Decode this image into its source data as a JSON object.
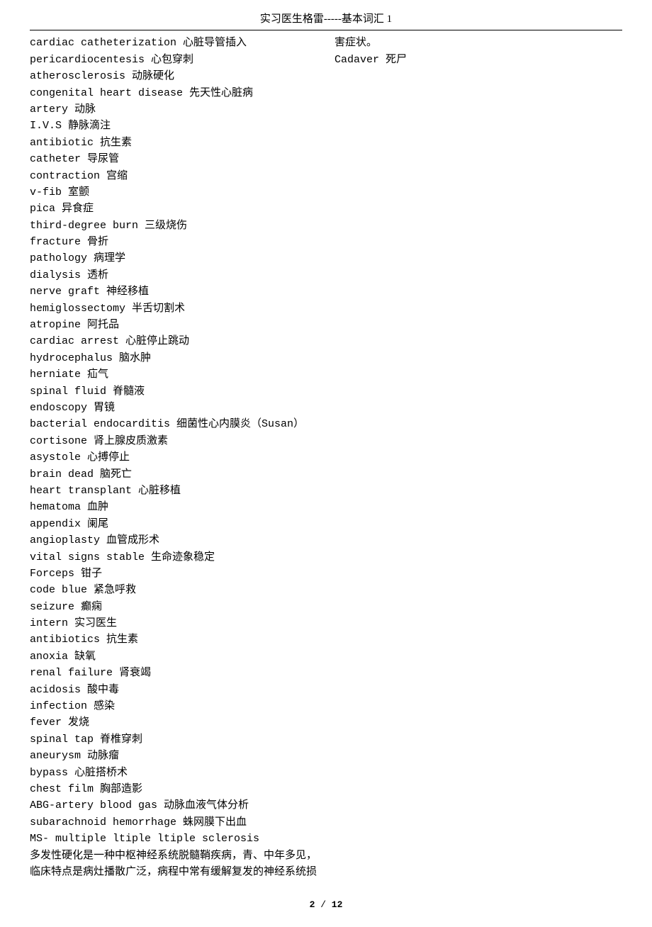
{
  "header": "实习医生格雷-----基本词汇 1",
  "terms": [
    {
      "text": "cardiac catheterization 心脏导管插入",
      "type": "term"
    },
    {
      "text": "pericardiocentesis 心包穿刺",
      "type": "term"
    },
    {
      "text": "atherosclerosis 动脉硬化",
      "type": "term"
    },
    {
      "text": "congenital heart disease 先天性心脏病",
      "type": "term"
    },
    {
      "text": "artery 动脉",
      "type": "term"
    },
    {
      "text": "I.V.S 静脉滴注",
      "type": "term"
    },
    {
      "text": "antibiotic 抗生素",
      "type": "term"
    },
    {
      "text": "catheter 导尿管",
      "type": "term"
    },
    {
      "text": "contraction 宫缩",
      "type": "term"
    },
    {
      "text": "v-fib 室颤",
      "type": "term"
    },
    {
      "text": "pica 异食症",
      "type": "term"
    },
    {
      "text": "third-degree burn 三级烧伤",
      "type": "term"
    },
    {
      "text": "fracture 骨折",
      "type": "term"
    },
    {
      "text": "pathology 病理学",
      "type": "term"
    },
    {
      "text": "dialysis 透析",
      "type": "term"
    },
    {
      "text": "nerve graft 神经移植",
      "type": "term"
    },
    {
      "text": "hemiglossectomy 半舌切割术",
      "type": "term"
    },
    {
      "text": "atropine 阿托品",
      "type": "term"
    },
    {
      "text": "cardiac arrest 心脏停止跳动",
      "type": "term"
    },
    {
      "text": "hydrocephalus 脑水肿",
      "type": "term"
    },
    {
      "text": "herniate 疝气",
      "type": "term"
    },
    {
      "text": "spinal fluid 脊髓液",
      "type": "term"
    },
    {
      "text": "endoscopy 胃镜",
      "type": "term"
    },
    {
      "text": "bacterial endocarditis 细菌性心内膜炎（Susan）",
      "type": "term"
    },
    {
      "text": "cortisone 肾上腺皮质激素",
      "type": "term"
    },
    {
      "text": "asystole 心搏停止",
      "type": "term"
    },
    {
      "text": "brain dead 脑死亡",
      "type": "term"
    },
    {
      "text": "heart transplant 心脏移植",
      "type": "term"
    },
    {
      "text": "hematoma 血肿",
      "type": "term"
    },
    {
      "text": "appendix 阑尾",
      "type": "term"
    },
    {
      "text": "angioplasty 血管成形术",
      "type": "term"
    },
    {
      "text": "vital signs stable 生命迹象稳定",
      "type": "term"
    },
    {
      "text": "Forceps 钳子",
      "type": "term"
    },
    {
      "text": "code blue 紧急呼救",
      "type": "term"
    },
    {
      "text": "seizure 癫痫",
      "type": "term"
    },
    {
      "text": "intern 实习医生",
      "type": "term"
    },
    {
      "text": "antibiotics 抗生素",
      "type": "term"
    },
    {
      "text": "anoxia 缺氧",
      "type": "term"
    },
    {
      "text": "renal failure 肾衰竭",
      "type": "term"
    },
    {
      "text": "acidosis 酸中毒",
      "type": "term"
    },
    {
      "text": "infection 感染",
      "type": "term"
    },
    {
      "text": "fever 发烧",
      "type": "term"
    },
    {
      "text": "spinal tap 脊椎穿刺",
      "type": "term"
    },
    {
      "text": "aneurysm 动脉瘤",
      "type": "term"
    },
    {
      "text": "bypass 心脏搭桥术",
      "type": "term"
    },
    {
      "text": "chest film 胸部造影",
      "type": "term"
    },
    {
      "text": "ABG-artery blood gas 动脉血液气体分析",
      "type": "term"
    },
    {
      "text": "subarachnoid hemorrhage 蛛网膜下出血",
      "type": "term"
    },
    {
      "text": "MS- multiple ltiple ltiple sclerosis",
      "type": "term"
    },
    {
      "text": "多发性硬化是一种中枢神经系统脱髓鞘疾病，青、中年多见，临床特点是病灶播散广泛，病程中常有缓解复发的神经系统损害症状。",
      "type": "desc"
    },
    {
      "text": "Cadaver 死尸",
      "type": "term"
    }
  ],
  "footer": {
    "current": "2",
    "sep": " / ",
    "total": "12"
  }
}
